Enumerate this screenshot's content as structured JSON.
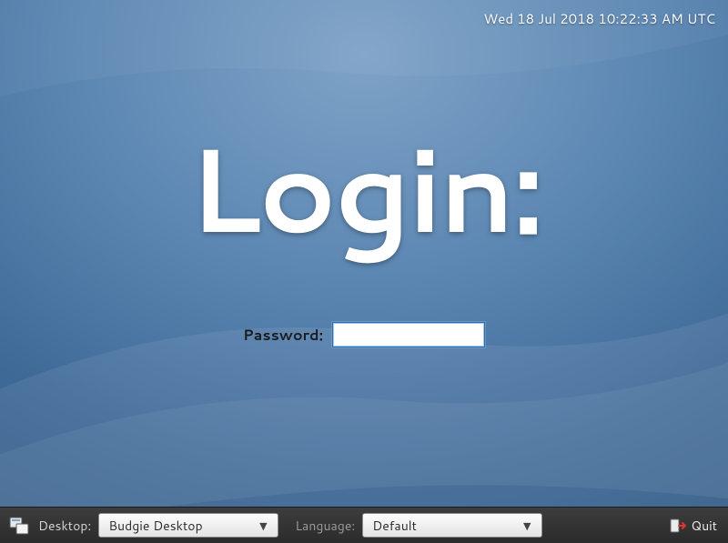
{
  "clock": "Wed 18 Jul 2018 10:22:33 AM UTC",
  "login_title": "Login:",
  "password_label": "Password:",
  "password_value": "",
  "panel": {
    "desktop_label": "Desktop:",
    "desktop_value": "Budgie Desktop",
    "language_label": "Language:",
    "language_value": "Default",
    "quit_label": "Quit"
  }
}
